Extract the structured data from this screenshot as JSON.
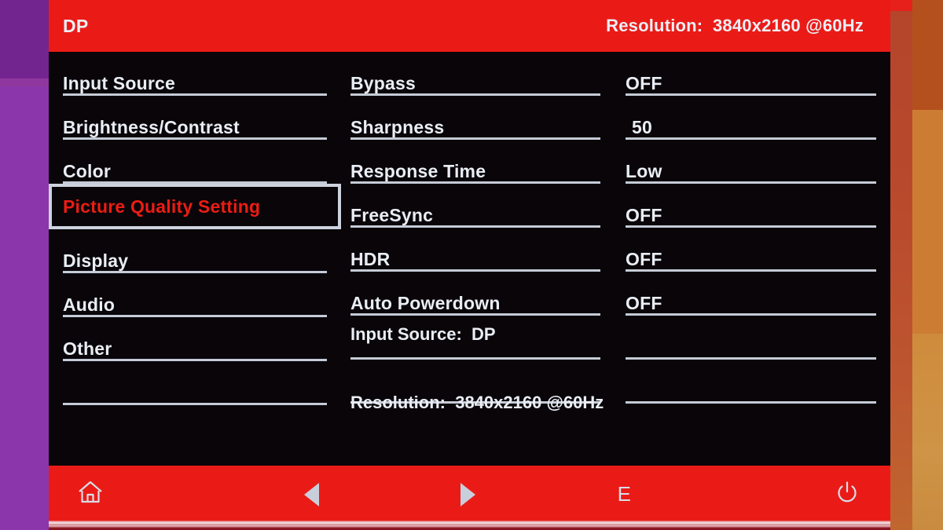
{
  "header": {
    "input_source": "DP",
    "resolution_label": "Resolution:",
    "resolution_value": "3840x2160 @60Hz",
    "resolution_full": "Resolution:  3840x2160 @60Hz"
  },
  "menu": {
    "items": [
      {
        "label": "Input Source",
        "selected": false
      },
      {
        "label": "Brightness/Contrast",
        "selected": false
      },
      {
        "label": "Color",
        "selected": false
      },
      {
        "label": "Picture Quality Setting",
        "selected": true
      },
      {
        "label": "Display",
        "selected": false
      },
      {
        "label": "Audio",
        "selected": false
      },
      {
        "label": "Other",
        "selected": false
      },
      {
        "label": "",
        "selected": false
      }
    ]
  },
  "settings": {
    "rows": [
      {
        "name": "Bypass",
        "value": "OFF"
      },
      {
        "name": "Sharpness",
        "value": "50"
      },
      {
        "name": "Response Time",
        "value": "Low"
      },
      {
        "name": "FreeSync",
        "value": "OFF"
      },
      {
        "name": "HDR",
        "value": "OFF"
      },
      {
        "name": "Auto Powerdown",
        "value": "OFF"
      },
      {
        "name": "",
        "value": ""
      },
      {
        "name": "",
        "value": ""
      }
    ]
  },
  "status": {
    "input_source_line": "Input Source:  DP",
    "resolution_line": "Resolution:  3840x2160 @60Hz"
  },
  "footer": {
    "buttons": [
      {
        "name": "home",
        "icon": "home-icon",
        "label": ""
      },
      {
        "name": "previous",
        "icon": "triangle-left-icon",
        "label": ""
      },
      {
        "name": "next",
        "icon": "triangle-right-icon",
        "label": ""
      },
      {
        "name": "exit",
        "icon": "",
        "label": "E"
      },
      {
        "name": "power",
        "icon": "power-icon",
        "label": ""
      }
    ]
  },
  "colors": {
    "osd_red": "#ea1b17",
    "osd_black": "#0a0608",
    "highlight_text": "#ec1c13",
    "text": "#e9edf4",
    "separator": "#c5cbd6",
    "background_left": "#8c36ab",
    "background_right": "#cc7d33"
  }
}
